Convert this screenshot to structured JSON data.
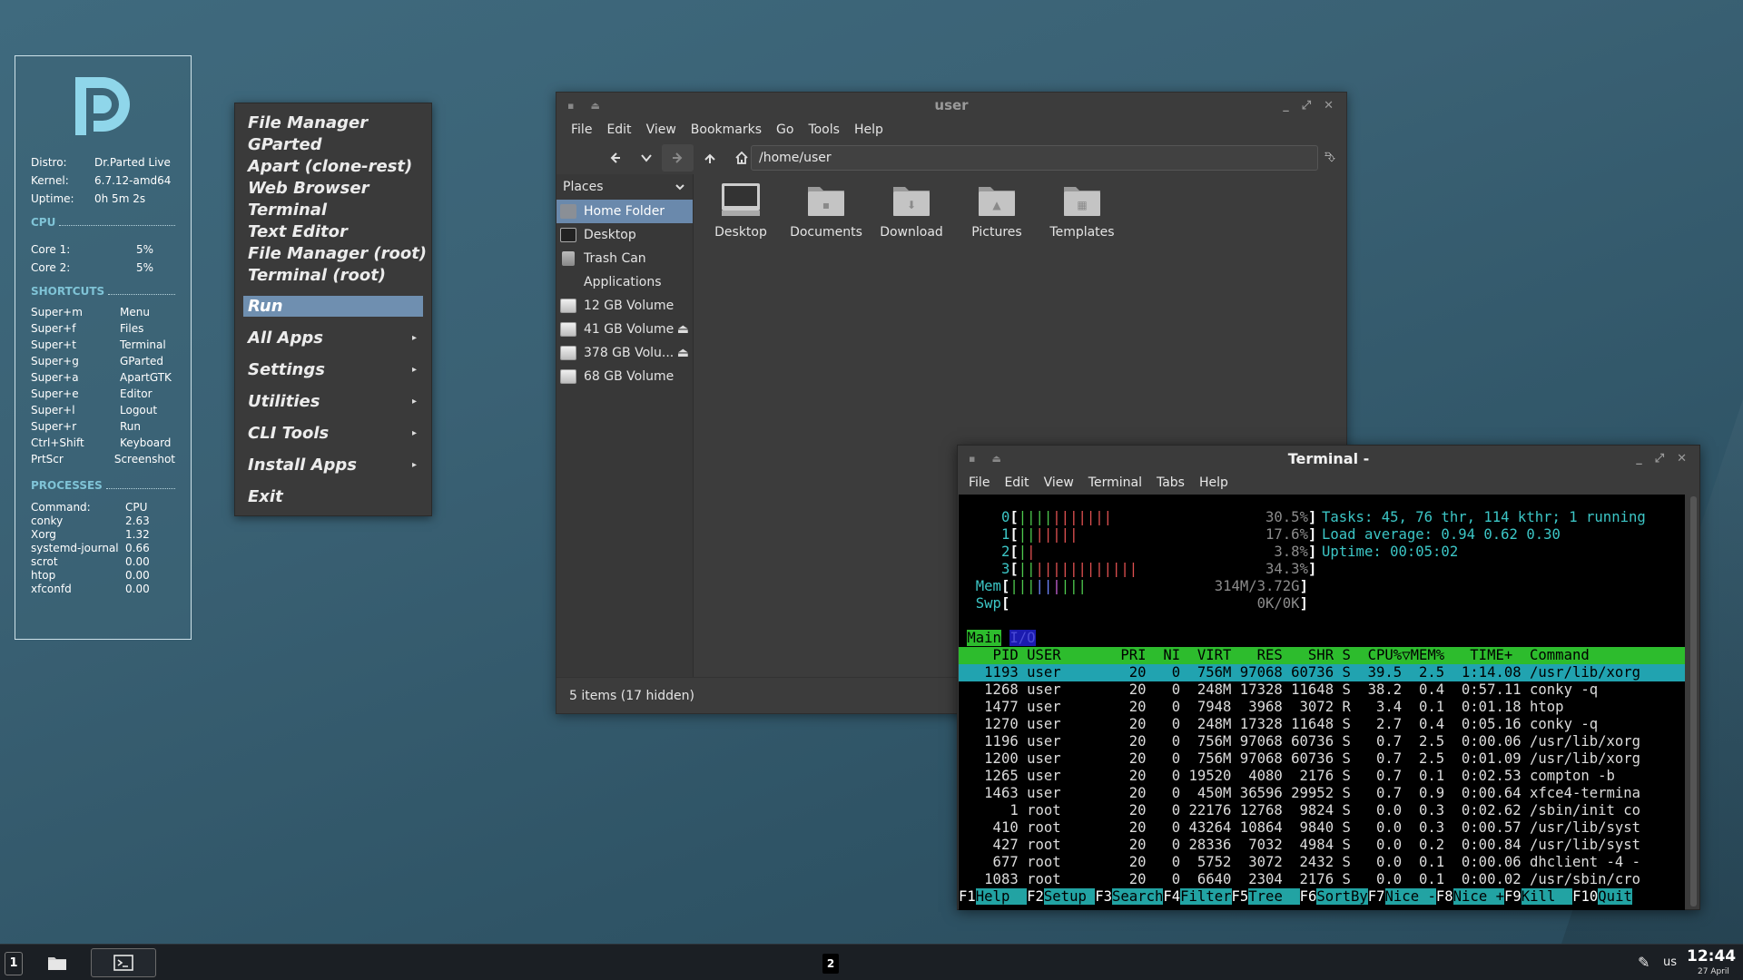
{
  "conky": {
    "info": [
      {
        "label": "Distro:",
        "value": "Dr.Parted Live"
      },
      {
        "label": "Kernel:",
        "value": "6.7.12-amd64"
      },
      {
        "label": "Uptime:",
        "value": "0h 5m 2s"
      }
    ],
    "cpu_title": "CPU",
    "cores": [
      {
        "label": "Core 1:",
        "value": "5%"
      },
      {
        "label": "Core 2:",
        "value": "5%"
      }
    ],
    "shortcuts_title": "SHORTCUTS",
    "shortcuts": [
      {
        "key": "Super+m",
        "action": "Menu"
      },
      {
        "key": "Super+f",
        "action": "Files"
      },
      {
        "key": "Super+t",
        "action": "Terminal"
      },
      {
        "key": "Super+g",
        "action": "GParted"
      },
      {
        "key": "Super+a",
        "action": "ApartGTK"
      },
      {
        "key": "Super+e",
        "action": "Editor"
      },
      {
        "key": "Super+l",
        "action": "Logout"
      },
      {
        "key": "Super+r",
        "action": "Run"
      },
      {
        "key": "Ctrl+Shift",
        "action": "Keyboard"
      },
      {
        "key": "PrtScr",
        "action": "Screenshot"
      }
    ],
    "processes_title": "PROCESSES",
    "processes": [
      {
        "name": "Command:",
        "cpu": "CPU"
      },
      {
        "name": "conky",
        "cpu": "2.63"
      },
      {
        "name": "Xorg",
        "cpu": "1.32"
      },
      {
        "name": "systemd-journal",
        "cpu": "0.66"
      },
      {
        "name": "scrot",
        "cpu": "0.00"
      },
      {
        "name": "htop",
        "cpu": "0.00"
      },
      {
        "name": "xfconfd",
        "cpu": "0.00"
      }
    ],
    "logo_color": "#8fd6ea"
  },
  "menu": {
    "favorites": [
      "File Manager",
      "GParted",
      "Apart  (clone-rest)",
      "Web Browser",
      "Terminal",
      "Text Editor",
      "File Manager (root)",
      "Terminal (root)"
    ],
    "run": "Run",
    "submenus": [
      "All Apps",
      "Settings",
      "Utilities",
      "CLI Tools",
      "Install Apps"
    ],
    "exit": "Exit"
  },
  "filemanager": {
    "title": "user",
    "menubar": [
      "File",
      "Edit",
      "View",
      "Bookmarks",
      "Go",
      "Tools",
      "Help"
    ],
    "path": "/home/user",
    "places_label": "Places",
    "places": [
      {
        "label": "Home Folder",
        "icon": "home-icon",
        "selected": true
      },
      {
        "label": "Desktop",
        "icon": "desktop-icon"
      },
      {
        "label": "Trash Can",
        "icon": "trash-icon"
      },
      {
        "label": "Applications",
        "icon": "applications-icon"
      },
      {
        "label": "12 GB Volume",
        "icon": "drive-icon"
      },
      {
        "label": "41 GB Volume",
        "icon": "drive-icon",
        "eject": true
      },
      {
        "label": "378 GB Volu...",
        "icon": "drive-icon",
        "eject": true
      },
      {
        "label": "68 GB Volume",
        "icon": "drive-icon"
      }
    ],
    "files": [
      "Desktop",
      "Documents",
      "Download",
      "Pictures",
      "Templates"
    ],
    "status": "5 items (17 hidden)"
  },
  "terminal": {
    "title": "Terminal -",
    "menubar": [
      "File",
      "Edit",
      "View",
      "Terminal",
      "Tabs",
      "Help"
    ],
    "meters": [
      {
        "label": "0",
        "pct": "30.5%"
      },
      {
        "label": "1",
        "pct": "17.6%"
      },
      {
        "label": "2",
        "pct": "3.8%"
      },
      {
        "label": "3",
        "pct": "34.3%"
      },
      {
        "label": "Mem",
        "pct": "314M/3.72G"
      },
      {
        "label": "Swp",
        "pct": "0K/0K"
      }
    ],
    "tasks_line": "Tasks: 45, 76 thr, 114 kthr; 1 running",
    "load_line": "Load average: 0.94 0.62 0.30",
    "uptime_line": "Uptime: 00:05:02",
    "tab_main": "Main",
    "tab_io": "I/O",
    "header": "    PID USER       PRI  NI  VIRT   RES   SHR S  CPU%▽MEM%   TIME+  Command",
    "rows": [
      "   1193 user        20   0  756M 97068 60736 S  39.5  2.5  1:14.08 /usr/lib/xorg",
      "   1268 user        20   0  248M 17328 11648 S  38.2  0.4  0:57.11 conky -q",
      "   1477 user        20   0  7948  3968  3072 R   3.4  0.1  0:01.18 htop",
      "   1270 user        20   0  248M 17328 11648 S   2.7  0.4  0:05.16 conky -q",
      "   1196 user        20   0  756M 97068 60736 S   0.7  2.5  0:00.06 /usr/lib/xorg",
      "   1200 user        20   0  756M 97068 60736 S   0.7  2.5  0:01.09 /usr/lib/xorg",
      "   1265 user        20   0 19520  4080  2176 S   0.7  0.1  0:02.53 compton -b",
      "   1463 user        20   0  450M 36596 29952 S   0.7  0.9  0:00.64 xfce4-termina",
      "      1 root        20   0 22176 12768  9824 S   0.0  0.3  0:02.62 /sbin/init co",
      "    410 root        20   0 43264 10864  9840 S   0.0  0.3  0:00.57 /usr/lib/syst",
      "    427 root        20   0 28336  7032  4984 S   0.0  0.2  0:00.84 /usr/lib/syst",
      "    677 root        20   0  5752  3072  2432 S   0.0  0.1  0:00.06 dhclient -4 -",
      "   1083 root        20   0  6640  2304  2176 S   0.0  0.1  0:00.02 /usr/sbin/cro"
    ],
    "fkeys": [
      {
        "k": "F1",
        "l": "Help  "
      },
      {
        "k": "F2",
        "l": "Setup "
      },
      {
        "k": "F3",
        "l": "Search"
      },
      {
        "k": "F4",
        "l": "Filter"
      },
      {
        "k": "F5",
        "l": "Tree  "
      },
      {
        "k": "F6",
        "l": "SortBy"
      },
      {
        "k": "F7",
        "l": "Nice -"
      },
      {
        "k": "F8",
        "l": "Nice +"
      },
      {
        "k": "F9",
        "l": "Kill  "
      },
      {
        "k": "F10",
        "l": "Quit"
      }
    ]
  },
  "taskbar": {
    "workspace1": "1",
    "workspace2": "2",
    "keyboard": "us",
    "clock": "12:44",
    "date": "27 April"
  }
}
